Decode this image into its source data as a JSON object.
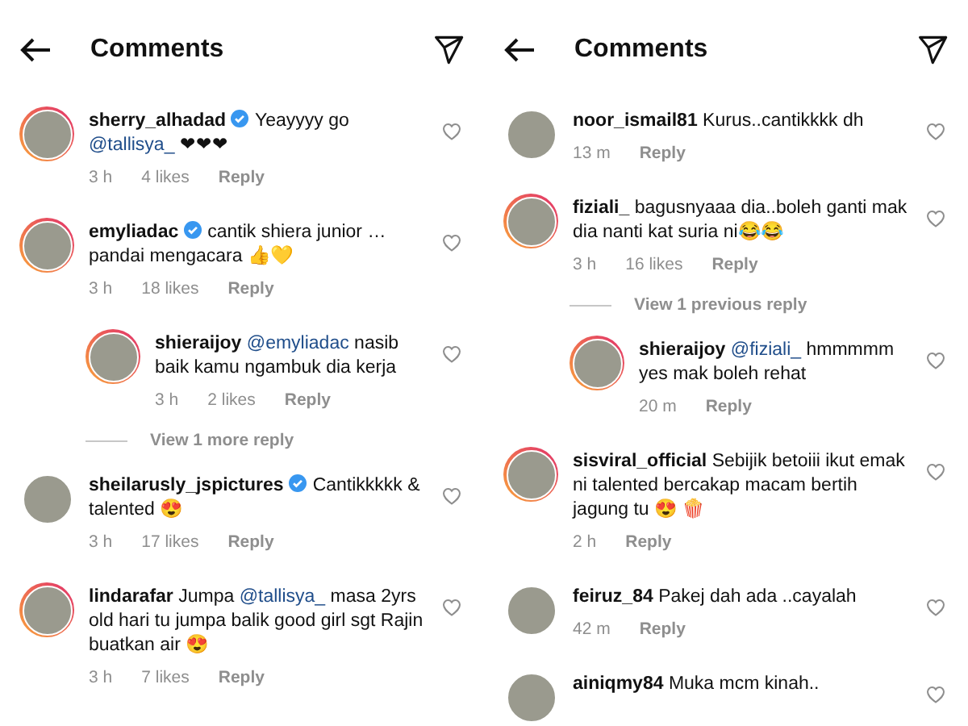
{
  "panels": [
    {
      "title": "Comments",
      "comments": [
        {
          "kind": "comment",
          "user": "sherry_alhadad",
          "verified": true,
          "ring": true,
          "text": [
            {
              "kind": "plain",
              "text": "Yeayyyy go "
            },
            {
              "kind": "mention",
              "text": "@tallisya_"
            },
            {
              "kind": "plain",
              "text": " ❤❤❤"
            }
          ],
          "time": "3 h",
          "likes": "4 likes",
          "reply": "Reply"
        },
        {
          "kind": "comment",
          "user": "emyliadac",
          "verified": true,
          "ring": true,
          "text": [
            {
              "kind": "plain",
              "text": "cantik shiera junior … pandai mengacara 👍💛"
            }
          ],
          "time": "3 h",
          "likes": "18 likes",
          "reply": "Reply",
          "children": [
            {
              "kind": "comment",
              "user": "shieraijoy",
              "verified": false,
              "ring": true,
              "text": [
                {
                  "kind": "mention",
                  "text": "@emyliadac"
                },
                {
                  "kind": "plain",
                  "text": " nasib baik kamu ngambuk dia kerja"
                }
              ],
              "time": "3 h",
              "likes": "2 likes",
              "reply": "Reply"
            },
            {
              "kind": "view",
              "label": "View 1 more reply"
            }
          ]
        },
        {
          "kind": "comment",
          "user": "sheilarusly_jspictures",
          "verified": true,
          "ring": false,
          "text": [
            {
              "kind": "plain",
              "text": "Cantikkkkk & talented 😍"
            }
          ],
          "time": "3 h",
          "likes": "17 likes",
          "reply": "Reply"
        },
        {
          "kind": "comment",
          "user": "lindarafar",
          "verified": false,
          "ring": true,
          "text": [
            {
              "kind": "plain",
              "text": "Jumpa "
            },
            {
              "kind": "mention",
              "text": "@tallisya_"
            },
            {
              "kind": "plain",
              "text": " masa 2yrs old hari tu jumpa balik good girl sgt Rajin buatkan air 😍"
            }
          ],
          "time": "3 h",
          "likes": "7 likes",
          "reply": "Reply"
        }
      ]
    },
    {
      "title": "Comments",
      "comments": [
        {
          "kind": "comment",
          "user": "noor_ismail81",
          "verified": false,
          "ring": false,
          "text": [
            {
              "kind": "plain",
              "text": "Kurus..cantikkkk dh"
            }
          ],
          "time": "13 m",
          "reply": "Reply"
        },
        {
          "kind": "comment",
          "user": "fiziali_",
          "verified": false,
          "ring": true,
          "text": [
            {
              "kind": "plain",
              "text": "bagusnyaaa dia..boleh ganti mak dia nanti kat suria ni😂😂"
            }
          ],
          "time": "3 h",
          "likes": "16 likes",
          "reply": "Reply",
          "children": [
            {
              "kind": "view",
              "label": "View 1 previous reply"
            },
            {
              "kind": "comment",
              "user": "shieraijoy",
              "verified": false,
              "ring": true,
              "text": [
                {
                  "kind": "mention",
                  "text": "@fiziali_"
                },
                {
                  "kind": "plain",
                  "text": " hmmmmm yes mak boleh rehat"
                }
              ],
              "time": "20 m",
              "reply": "Reply"
            }
          ]
        },
        {
          "kind": "comment",
          "user": "sisviral_official",
          "verified": false,
          "ring": true,
          "text": [
            {
              "kind": "plain",
              "text": "Sebijik betoiii ikut emak ni talented bercakap macam bertih jagung tu 😍 🍿"
            }
          ],
          "time": "2 h",
          "reply": "Reply"
        },
        {
          "kind": "comment",
          "user": "feiruz_84",
          "verified": false,
          "ring": false,
          "text": [
            {
              "kind": "plain",
              "text": "Pakej dah ada ..cayalah"
            }
          ],
          "time": "42 m",
          "reply": "Reply"
        },
        {
          "kind": "comment",
          "user": "ainiqmy84",
          "verified": false,
          "ring": false,
          "text": [
            {
              "kind": "plain",
              "text": "Muka mcm kinah.."
            }
          ]
        }
      ]
    }
  ]
}
